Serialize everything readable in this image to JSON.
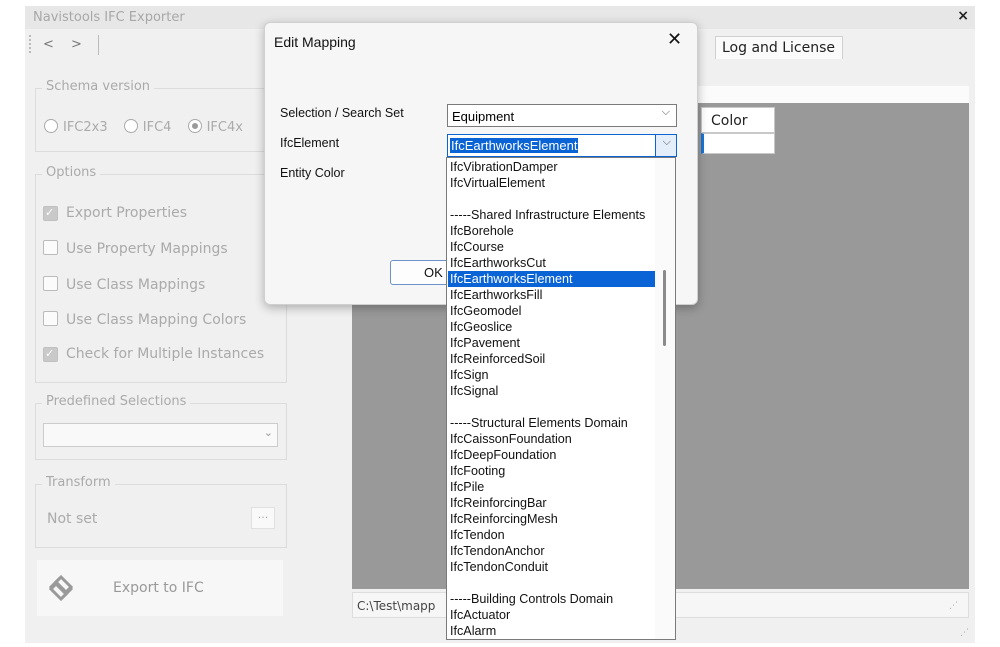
{
  "app": {
    "title": "Navistools IFC Exporter",
    "close_glyph": "×",
    "nav_back": "<",
    "nav_forward": ">"
  },
  "left_panel": {
    "schema": {
      "legend": "Schema version",
      "options": [
        "IFC2x3",
        "IFC4",
        "IFC4x"
      ],
      "selected": "IFC4x"
    },
    "options": {
      "legend": "Options",
      "items": [
        {
          "label": "Export Properties",
          "checked": true
        },
        {
          "label": "Use Property Mappings",
          "checked": false
        },
        {
          "label": "Use Class Mappings",
          "checked": false
        },
        {
          "label": "Use Class Mapping Colors",
          "checked": false
        },
        {
          "label": "Check for Multiple Instances",
          "checked": true
        }
      ]
    },
    "predefined": {
      "legend": "Predefined Selections",
      "value": ""
    },
    "transform": {
      "legend": "Transform",
      "value": "Not set",
      "button": "..."
    },
    "export": {
      "label": "Export to IFC",
      "icon": "ifc-logo-icon"
    }
  },
  "tabs": {
    "visible_label": "Log and License"
  },
  "grid": {
    "color_header": "Color"
  },
  "path_bar": {
    "text": "C:\\Test\\mapp"
  },
  "dialog": {
    "title": "Edit Mapping",
    "close_glyph": "✕",
    "labels": {
      "selection": "Selection / Search Set",
      "element": "IfcElement",
      "entity_color": "Entity Color"
    },
    "selection_value": "Equipment",
    "element_value": "IfcEarthworksElement",
    "ok_label": "OK"
  },
  "dropdown_items": [
    "IfcVibrationDamper",
    "IfcVirtualElement",
    "",
    "-----Shared Infrastructure Elements",
    "IfcBorehole",
    "IfcCourse",
    "IfcEarthworksCut",
    "IfcEarthworksElement",
    "IfcEarthworksFill",
    "IfcGeomodel",
    "IfcGeoslice",
    "IfcPavement",
    "IfcReinforcedSoil",
    "IfcSign",
    "IfcSignal",
    "",
    "-----Structural Elements Domain",
    "IfcCaissonFoundation",
    "IfcDeepFoundation",
    "IfcFooting",
    "IfcPile",
    "IfcReinforcingBar",
    "IfcReinforcingMesh",
    "IfcTendon",
    "IfcTendonAnchor",
    "IfcTendonConduit",
    "",
    "-----Building Controls Domain",
    "IfcActuator",
    "IfcAlarm"
  ],
  "dropdown_selected": "IfcEarthworksElement",
  "colors": {
    "accent": "#0a64d6",
    "panel_gray": "#999999"
  }
}
